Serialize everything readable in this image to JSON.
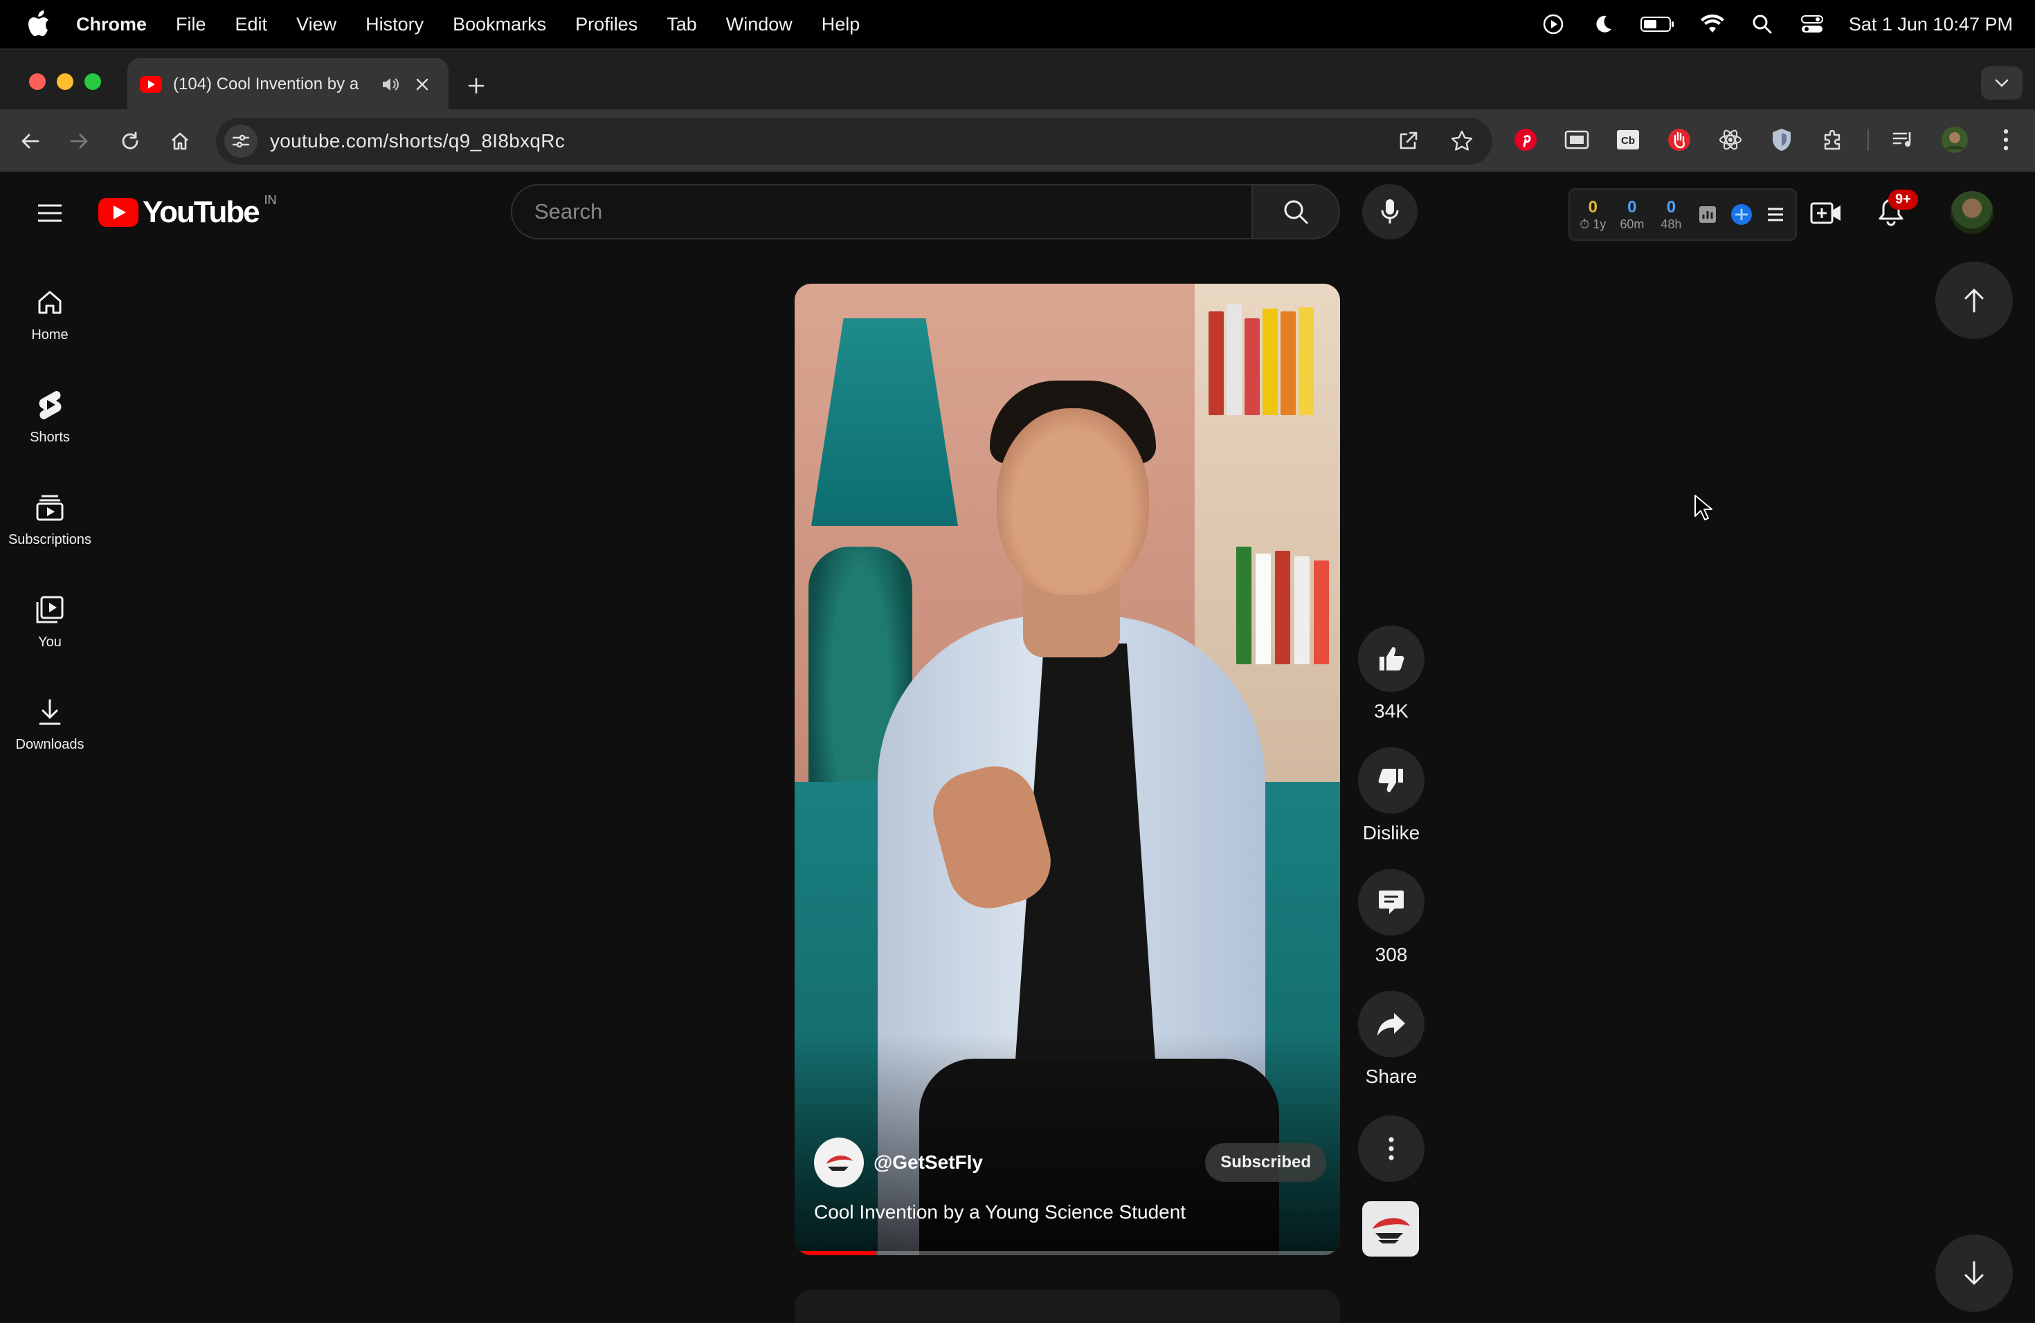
{
  "menubar": {
    "app_name": "Chrome",
    "items": [
      "File",
      "Edit",
      "View",
      "History",
      "Bookmarks",
      "Profiles",
      "Tab",
      "Window",
      "Help"
    ],
    "clock": "Sat 1 Jun  10:47 PM"
  },
  "browser": {
    "tab_title": "(104) Cool Invention by a",
    "url": "youtube.com/shorts/q9_8I8bxqRc"
  },
  "youtube": {
    "logo_text": "YouTube",
    "region": "IN",
    "search_placeholder": "Search",
    "stats": [
      {
        "value": "0",
        "label": "1y",
        "color": "#e2b93b"
      },
      {
        "value": "0",
        "label": "60m",
        "color": "#4da3ff"
      },
      {
        "value": "0",
        "label": "48h",
        "color": "#4da3ff"
      }
    ],
    "notification_badge": "9+",
    "sidebar": [
      {
        "label": "Home",
        "icon": "home-icon"
      },
      {
        "label": "Shorts",
        "icon": "shorts-icon"
      },
      {
        "label": "Subscriptions",
        "icon": "subscriptions-icon"
      },
      {
        "label": "You",
        "icon": "you-icon"
      },
      {
        "label": "Downloads",
        "icon": "download-icon"
      }
    ]
  },
  "short": {
    "channel": "@GetSetFly",
    "subscribe_label": "Subscribed",
    "title": "Cool Invention by a Young Science Student",
    "progress": 0.15,
    "actions": {
      "like": "34K",
      "dislike": "Dislike",
      "comments": "308",
      "share": "Share"
    }
  },
  "colors": {
    "brand_red": "#ff0000",
    "background": "#0f0f0f"
  }
}
